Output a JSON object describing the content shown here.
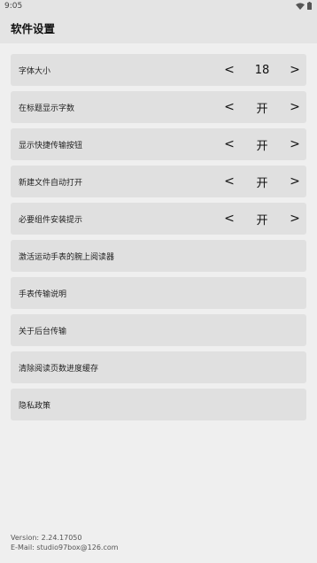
{
  "status": {
    "time": "9:05"
  },
  "header": {
    "title": "软件设置"
  },
  "settings": [
    {
      "label": "字体大小",
      "value": "18",
      "prev": "<",
      "next": ">"
    },
    {
      "label": "在标题显示字数",
      "value": "开",
      "prev": "<",
      "next": ">"
    },
    {
      "label": "显示快捷传输按钮",
      "value": "开",
      "prev": "<",
      "next": ">"
    },
    {
      "label": "新建文件自动打开",
      "value": "开",
      "prev": "<",
      "next": ">"
    },
    {
      "label": "必要组件安装提示",
      "value": "开",
      "prev": "<",
      "next": ">"
    }
  ],
  "links": [
    {
      "label": "激活运动手表的腕上阅读器"
    },
    {
      "label": "手表传输说明"
    },
    {
      "label": "关于后台传输"
    },
    {
      "label": "清除阅读页数进度缓存"
    },
    {
      "label": "隐私政策"
    }
  ],
  "footer": {
    "version": "Version: 2.24.17050",
    "email": "E-Mail: studio97box@126.com"
  }
}
